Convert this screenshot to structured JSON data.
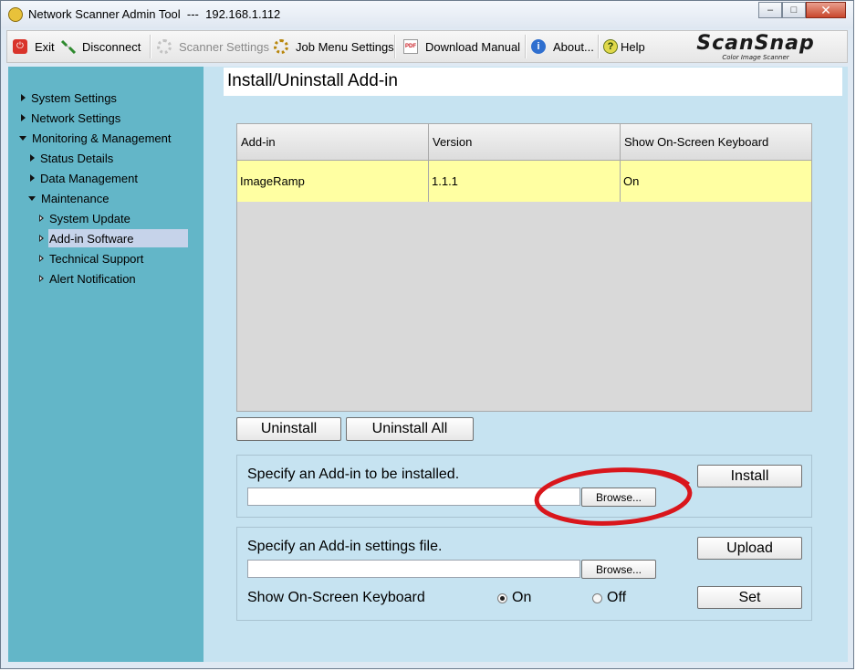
{
  "window": {
    "title": "Network Scanner Admin Tool  ---  192.168.1.112",
    "controls": {
      "minimize": "–",
      "maximize": "□",
      "close": "✕"
    }
  },
  "toolbar": {
    "exit": "Exit",
    "disconnect": "Disconnect",
    "scanner_settings": "Scanner Settings",
    "job_menu_settings": "Job Menu Settings",
    "download_manual": "Download Manual",
    "about": "About...",
    "help": "Help",
    "help_glyph": "?",
    "about_glyph": "i",
    "manual_glyph": "PDF",
    "exit_glyph": "⏻",
    "logo": {
      "name": "ScanSnap",
      "tagline": "Color Image Scanner"
    }
  },
  "sidebar": {
    "items": [
      {
        "label": "System Settings",
        "level": 0,
        "state": "collapsed"
      },
      {
        "label": "Network Settings",
        "level": 0,
        "state": "collapsed"
      },
      {
        "label": "Monitoring & Management",
        "level": 0,
        "state": "expanded"
      },
      {
        "label": "Status Details",
        "level": 1,
        "state": "collapsed"
      },
      {
        "label": "Data Management",
        "level": 1,
        "state": "collapsed"
      },
      {
        "label": "Maintenance",
        "level": 1,
        "state": "expanded"
      },
      {
        "label": "System Update",
        "level": 2,
        "state": "leaf"
      },
      {
        "label": "Add-in Software",
        "level": 2,
        "state": "leaf",
        "selected": true
      },
      {
        "label": "Technical Support",
        "level": 2,
        "state": "leaf"
      },
      {
        "label": "Alert Notification",
        "level": 2,
        "state": "leaf"
      }
    ]
  },
  "main": {
    "title": "Install/Uninstall Add-in",
    "table": {
      "columns": [
        "Add-in",
        "Version",
        "Show On-Screen Keyboard"
      ],
      "rows": [
        [
          "ImageRamp",
          "1.1.1",
          "On"
        ]
      ]
    },
    "uninstall": "Uninstall",
    "uninstall_all": "Uninstall All",
    "install_panel": {
      "label": "Specify an Add-in to be installed.",
      "file_value": "",
      "browse": "Browse...",
      "install": "Install"
    },
    "settings_panel": {
      "label": "Specify an Add-in settings file.",
      "file_value": "",
      "browse": "Browse...",
      "upload": "Upload",
      "keyboard_label": "Show On-Screen Keyboard",
      "on": "On",
      "off": "Off",
      "selected": "On",
      "set": "Set"
    }
  },
  "colors": {
    "sidebar": "#63b6c8",
    "content": "#c6e3f1",
    "row_highlight": "#ffffa2",
    "selected_nav": "#c6d3ea",
    "annotation": "#d9161c"
  }
}
